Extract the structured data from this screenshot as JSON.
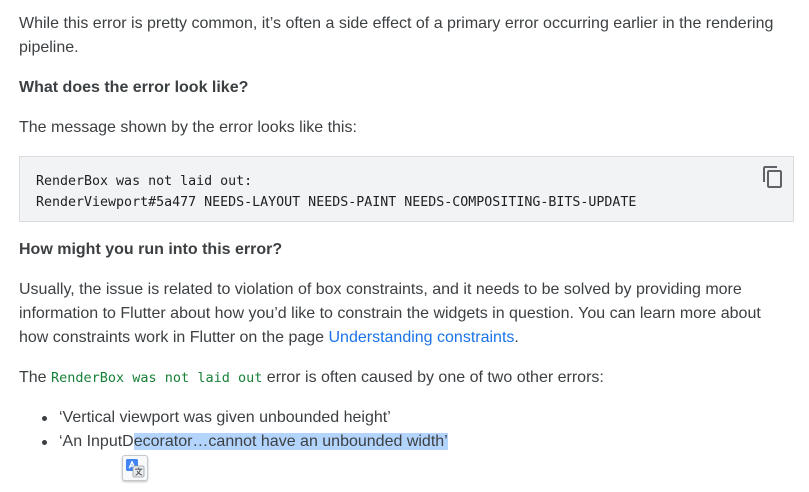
{
  "intro": {
    "text": "While this error is pretty common, it’s often a side effect of a primary error occurring earlier in the rendering pipeline."
  },
  "section1": {
    "heading": "What does the error look like?",
    "message": "The message shown by the error looks like this:"
  },
  "code_block": {
    "lines": [
      "RenderBox was not laid out:",
      "RenderViewport#5a477 NEEDS-LAYOUT NEEDS-PAINT NEEDS-COMPOSITING-BITS-UPDATE"
    ],
    "copy_icon": "copy-icon"
  },
  "section2": {
    "heading": "How might you run into this error?",
    "paragraph_before_link": "Usually, the issue is related to violation of box constraints, and it needs to be solved by providing more information to Flutter about how you’d like to constrain the widgets in question. You can learn more about how constraints work in Flutter on the page ",
    "link_text": "Understanding constraints",
    "paragraph_after_link": ".",
    "cause_prefix": "The ",
    "cause_code": "RenderBox was not laid out",
    "cause_suffix": " error is often caused by one of two other errors:"
  },
  "list": {
    "item1": "‘Vertical viewport was given unbounded height’",
    "item2_plain": "‘An InputD",
    "item2_selected": "ecorator…cannot have an unbounded width’"
  },
  "floating": {
    "icon": "translate-icon"
  },
  "colors": {
    "text": "#3c4043",
    "link": "#1a73e8",
    "inline_code": "#188038",
    "code_bg": "#f1f3f4",
    "selection": "#b3d4fc"
  }
}
